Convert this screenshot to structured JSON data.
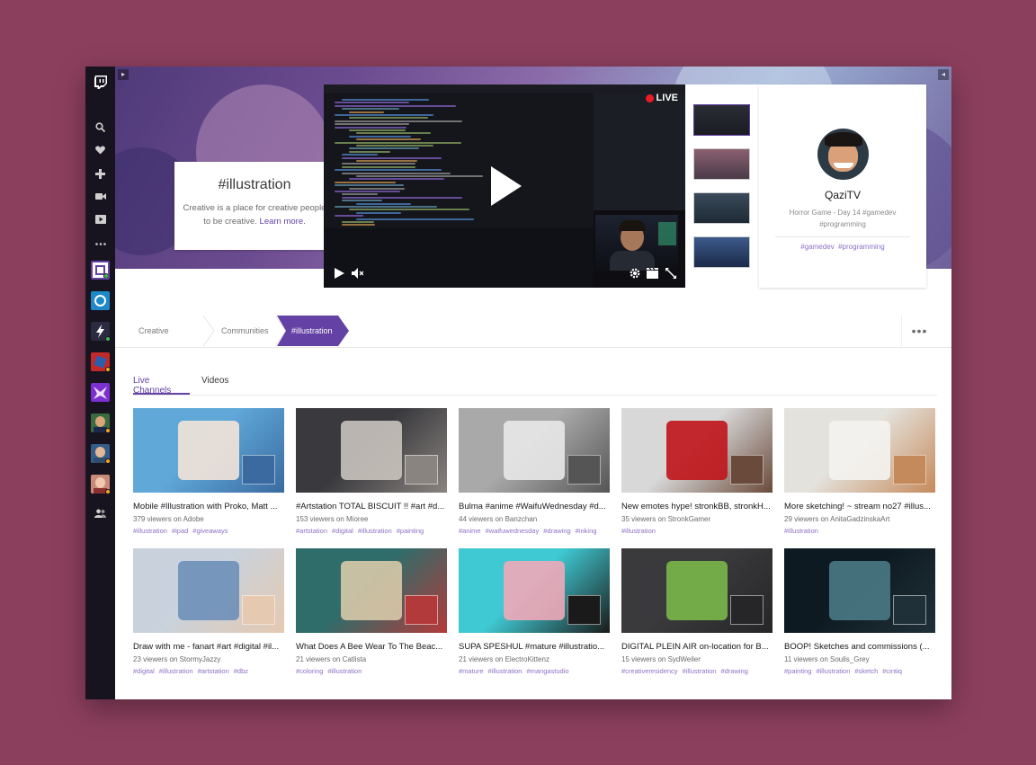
{
  "nav": {
    "icons": [
      "twitch-logo-icon",
      "search-icon",
      "heart-icon",
      "gamepad-icon",
      "camera-icon",
      "video-icon",
      "more-dots-icon",
      "community-icon"
    ],
    "avatar_colors": [
      "#1e88c8",
      "#2a2a40",
      "#c22a2a",
      "#7b2fd0",
      "#3a6b40",
      "#355d8a",
      "#c98a7a"
    ]
  },
  "community": {
    "name": "#illustration",
    "description": "Creative is a place for creative people to be creative.",
    "learn_more": "Learn more."
  },
  "player": {
    "live_label": "LIVE"
  },
  "channel": {
    "name": "QaziTV",
    "title": "Horror Game - Day 14 #gamedev #programming",
    "tags": [
      "#gamedev",
      "#programming"
    ]
  },
  "breadcrumb": {
    "items": [
      "Creative",
      "Communities",
      "#illustration"
    ],
    "more": "•••"
  },
  "tabs": {
    "live": "Live Channels",
    "videos": "Videos"
  },
  "streams": [
    {
      "title": "Mobile #Illustration with Proko, Matt ...",
      "meta": "379 viewers on Adobe",
      "tags": [
        "#illustration",
        "#ipad",
        "#giveaways"
      ],
      "colors": [
        "#5fa8d8",
        "#f3e3d8",
        "#3a6aa0"
      ]
    },
    {
      "title": "#Artstation TOTAL BISCUIT !! #art #d...",
      "meta": "153 viewers on Mioree",
      "tags": [
        "#artstation",
        "#digital",
        "#illustration",
        "#painting"
      ],
      "colors": [
        "#3a3a3e",
        "#c9c3bd",
        "#8a8480"
      ]
    },
    {
      "title": "Bulma #anime #WaifuWednesday #d...",
      "meta": "44 viewers on Banzchan",
      "tags": [
        "#anime",
        "#waifuwednesday",
        "#drawing",
        "#inking"
      ],
      "colors": [
        "#a9a9a9",
        "#e8e8e8",
        "#555555"
      ]
    },
    {
      "title": "New emotes hype! stronkBB, stronkH...",
      "meta": "35 viewers on StronkGamer",
      "tags": [
        "#illustration"
      ],
      "colors": [
        "#d8d8d8",
        "#c0141b",
        "#6a4a3a"
      ]
    },
    {
      "title": "More sketching! ~ stream no27 #illus...",
      "meta": "29 viewers on AnitaGadzinskaArt",
      "tags": [
        "#illustration"
      ],
      "colors": [
        "#e4e2dc",
        "#f4f3ef",
        "#c58a5c"
      ]
    },
    {
      "title": "Draw with me - fanart #art #digital #il...",
      "meta": "23 viewers on StormyJazzy",
      "tags": [
        "#digital",
        "#illustration",
        "#artstation",
        "#dbz"
      ],
      "colors": [
        "#c9d2dc",
        "#6d8fb8",
        "#e5c9b0"
      ]
    },
    {
      "title": "What Does A Bee Wear To The Beac...",
      "meta": "21 viewers on Catlista",
      "tags": [
        "#coloring",
        "#illustration"
      ],
      "colors": [
        "#2f6d6a",
        "#d8c9a8",
        "#b33a3a"
      ]
    },
    {
      "title": "SUPA SPESHUL #mature #illustratio...",
      "meta": "21 viewers on ElectroKittenz",
      "tags": [
        "#mature",
        "#illustration",
        "#mangastudio"
      ],
      "colors": [
        "#3fc9d2",
        "#f0a8b8",
        "#1a1a1a"
      ]
    },
    {
      "title": "DIGITAL PLEIN AIR on-location for B...",
      "meta": "15 viewers on SydWeiler",
      "tags": [
        "#creativeresidency",
        "#illustration",
        "#drawing"
      ],
      "colors": [
        "#3a3a3c",
        "#7ab84a",
        "#262628"
      ]
    },
    {
      "title": "BOOP! Sketches and commissions (...",
      "meta": "11 viewers on Soulis_Grey",
      "tags": [
        "#painting",
        "#illustration",
        "#sketch",
        "#cintiq"
      ],
      "colors": [
        "#0e1a22",
        "#4a7a86",
        "#203038"
      ]
    }
  ],
  "accent_color": "#6441a4"
}
